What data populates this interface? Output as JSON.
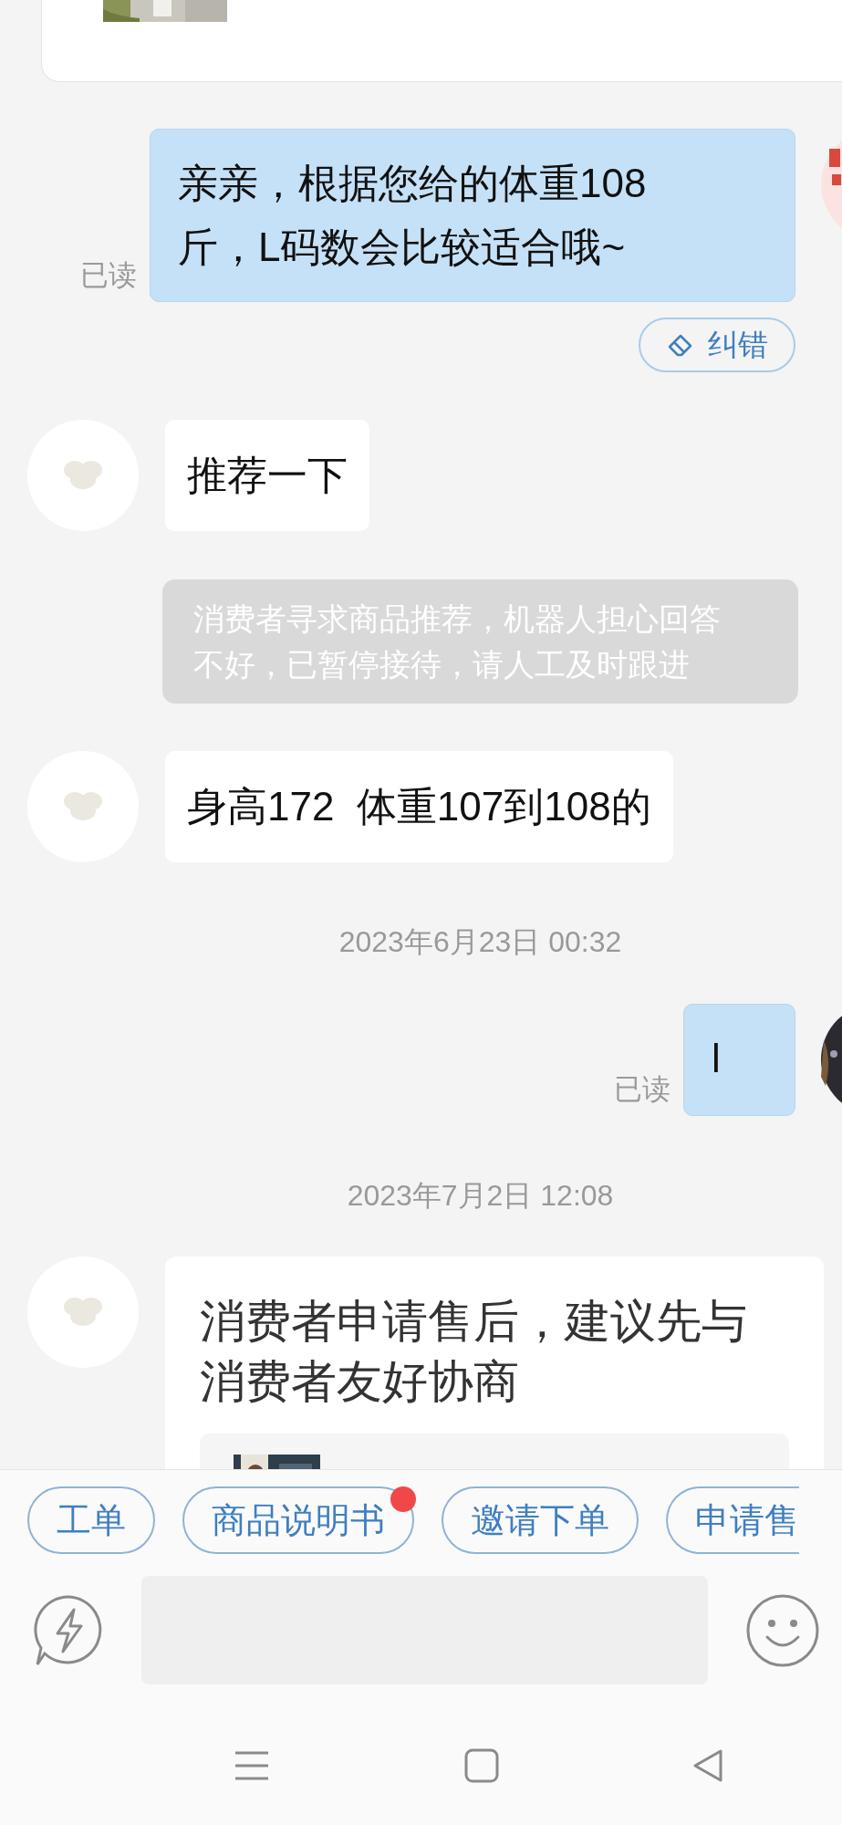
{
  "messages": [
    {
      "kind": "outgoing",
      "text": "亲亲，根据您给的体重108斤，L码数会比较适合哦~",
      "status": "已读"
    },
    {
      "kind": "action",
      "label": "纠错"
    },
    {
      "kind": "incoming",
      "text": "推荐一下"
    },
    {
      "kind": "system",
      "text": "消费者寻求商品推荐，机器人担心回答不好，已暂停接待，请人工及时跟进"
    },
    {
      "kind": "incoming",
      "text": "身高172  体重107到108的"
    },
    {
      "kind": "time",
      "text": "2023年6月23日 00:32"
    },
    {
      "kind": "outgoing",
      "text": "l",
      "status": "已读"
    },
    {
      "kind": "time",
      "text": "2023年7月2日 12:08"
    },
    {
      "kind": "card",
      "text": "消费者申请售后，建议先与消费者友好协商"
    }
  ],
  "quick_actions": [
    {
      "label": "工单",
      "badge": false
    },
    {
      "label": "商品说明书",
      "badge": true
    },
    {
      "label": "邀请下单",
      "badge": false
    },
    {
      "label": "申请售",
      "badge": false
    }
  ]
}
